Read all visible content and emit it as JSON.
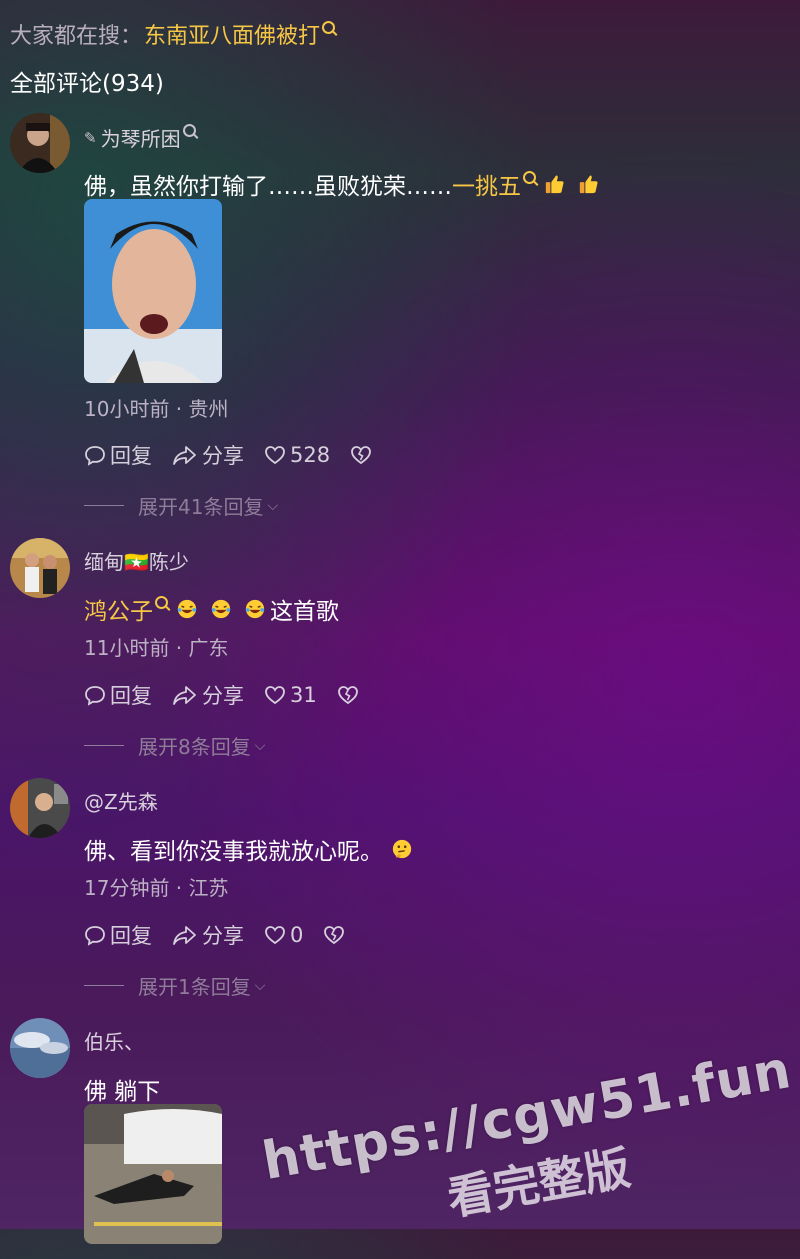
{
  "hot_search": {
    "label": "大家都在搜：",
    "keyword": "东南亚八面佛被打"
  },
  "comments_header": "全部评论(934)",
  "comments": [
    {
      "user": "为琴所困",
      "text_before": "佛，虽然你打输了……虽败犹荣……",
      "keyword": "一挑五",
      "emoji": "thumbs-up",
      "time_location": "10小时前 · 贵州",
      "reply_label": "回复",
      "share_label": "分享",
      "likes": "528",
      "expand_label": "展开41条回复"
    },
    {
      "user": "缅甸🇲🇲陈少",
      "keyword": "鸿公子",
      "text_after": "这首歌",
      "emoji": "laughing",
      "time_location": "11小时前 · 广东",
      "reply_label": "回复",
      "share_label": "分享",
      "likes": "31",
      "expand_label": "展开8条回复"
    },
    {
      "user": "@Z先森",
      "text": "佛、看到你没事我就放心呢。",
      "emoji": "thinking",
      "time_location": "17分钟前 · 江苏",
      "reply_label": "回复",
      "share_label": "分享",
      "likes": "0",
      "expand_label": "展开1条回复"
    },
    {
      "user": "伯乐、",
      "text": "佛 躺下"
    }
  ],
  "watermark": {
    "line1": "https://cgw51.fun",
    "line2": "看完整版"
  },
  "colors": {
    "keyword": "#f6c744",
    "background": "#5a0f63"
  }
}
